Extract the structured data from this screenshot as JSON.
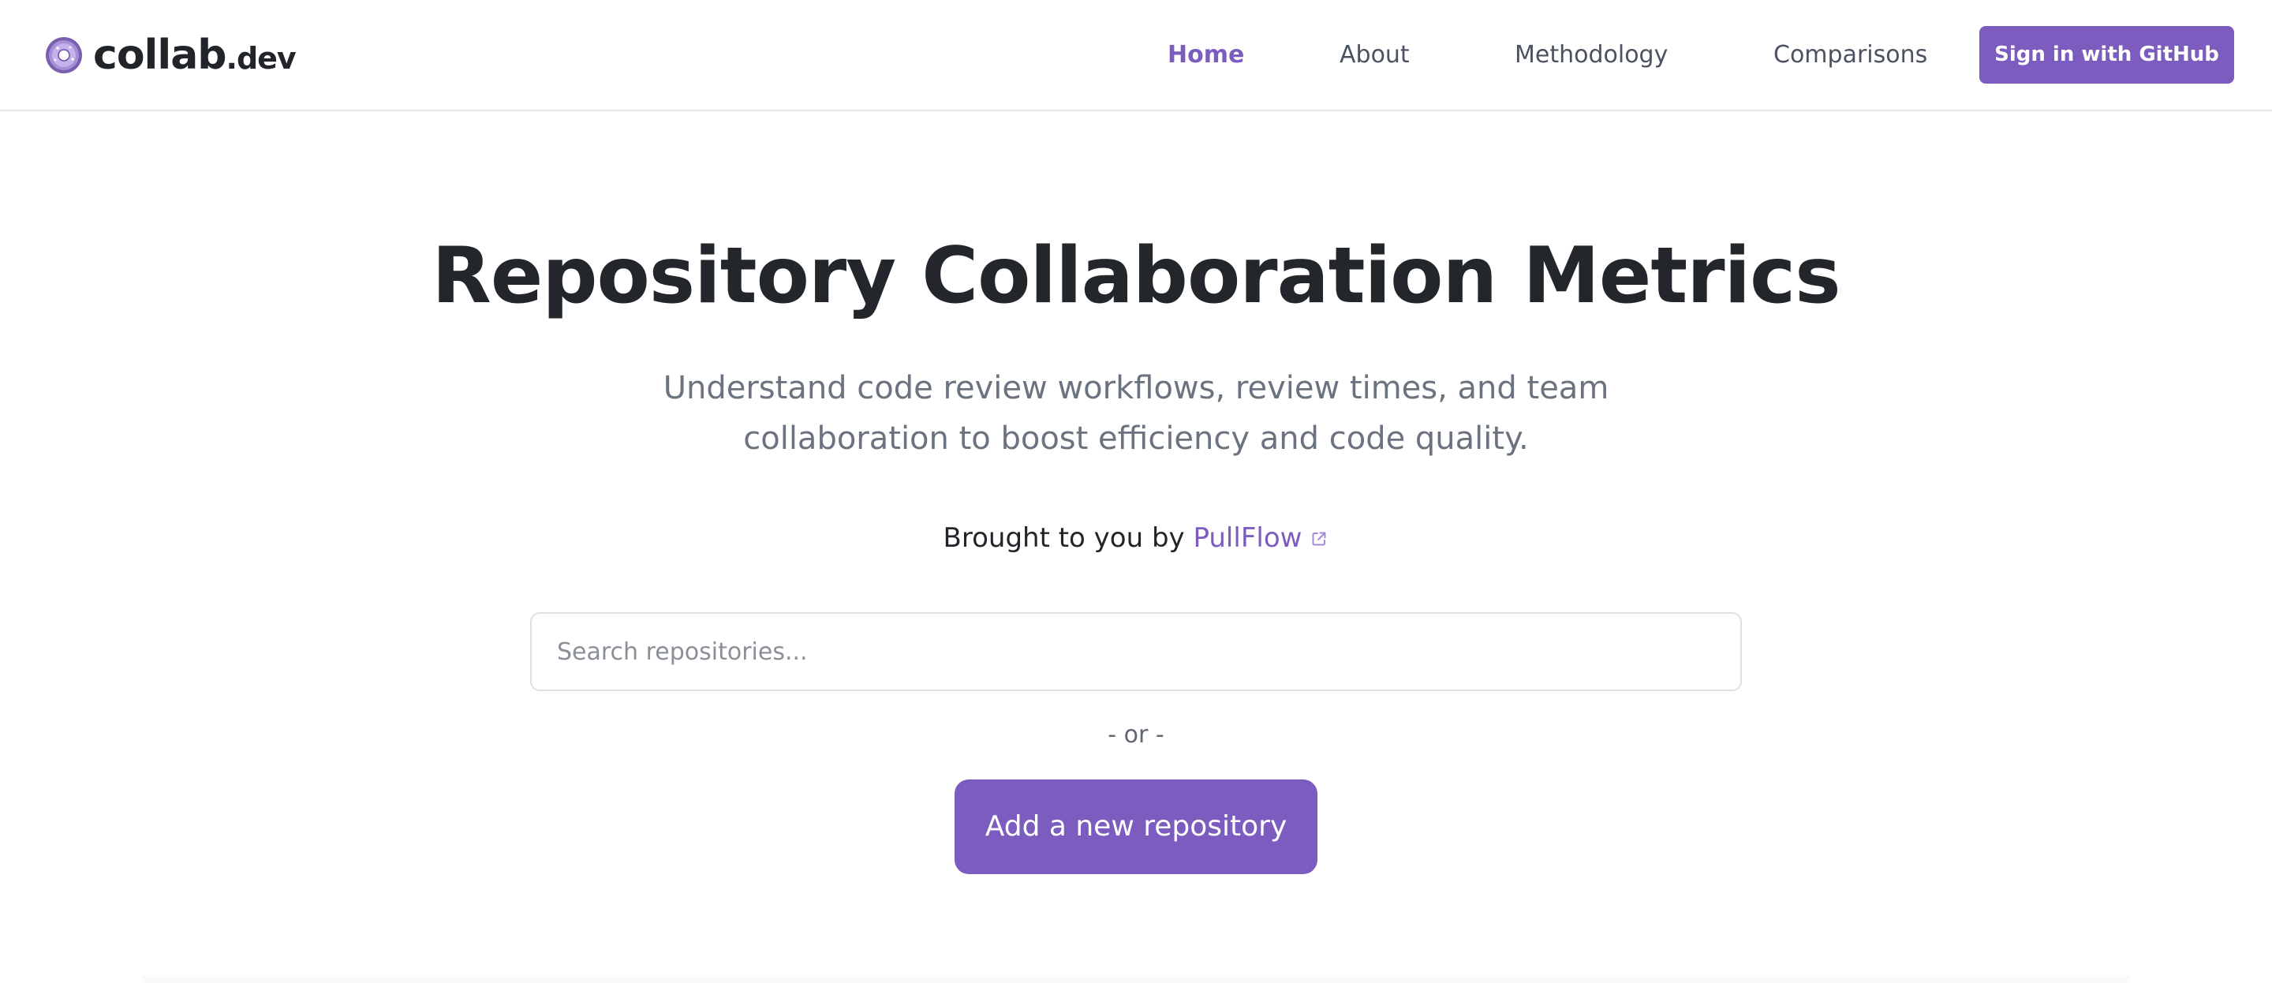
{
  "brand": {
    "name_main": "collab",
    "name_tld": ".dev",
    "logo_icon": "donut-logo-icon"
  },
  "nav": {
    "items": [
      {
        "label": "Home",
        "active": true
      },
      {
        "label": "About",
        "active": false
      },
      {
        "label": "Methodology",
        "active": false
      },
      {
        "label": "Comparisons",
        "active": false
      }
    ],
    "signin_label": "Sign in with GitHub"
  },
  "hero": {
    "title": "Repository Collaboration Metrics",
    "subtitle": "Understand code review workflows, review times, and team collaboration to boost efficiency and code quality.",
    "attribution_prefix": "Brought to you by",
    "attribution_link": "PullFlow",
    "attribution_icon": "external-link-icon"
  },
  "search": {
    "placeholder": "Search repositories...",
    "value": ""
  },
  "divider": {
    "label": "- or -"
  },
  "actions": {
    "add_repo_label": "Add a new repository"
  },
  "colors": {
    "accent": "#7c5cbf",
    "heading": "#23262b",
    "muted": "#6b7280",
    "nav_text": "#4b5262",
    "border": "#dee2e6"
  }
}
